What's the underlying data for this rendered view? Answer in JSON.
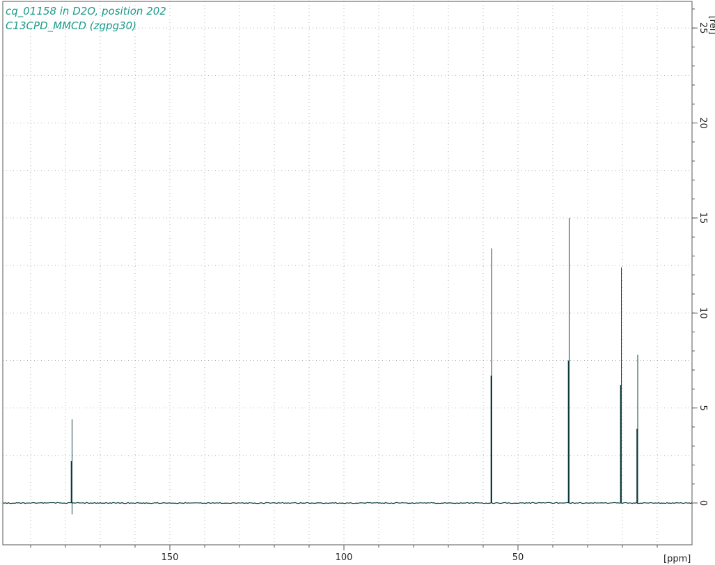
{
  "chart_data": {
    "type": "line",
    "title_lines": [
      "cq_01158 in D2O, position 202",
      "C13CPD_MMCD (zgpg30)"
    ],
    "xlabel": "[ppm]",
    "ylabel": "[rel]",
    "xlim": [
      198,
      0
    ],
    "ylim": [
      -2.2,
      26.4
    ],
    "x_ticks": [
      150,
      100,
      50
    ],
    "x_minor_ticks": [
      190,
      180,
      170,
      160,
      150,
      140,
      130,
      120,
      110,
      100,
      90,
      80,
      70,
      60,
      50,
      40,
      30,
      20,
      10
    ],
    "y_ticks": [
      0,
      5,
      10,
      15,
      20,
      25
    ],
    "grid": true,
    "line_color": "#0b3b3a",
    "title_color": "#1a9a8a",
    "baseline": 0,
    "peaks": [
      {
        "x": 178.1,
        "y": 4.4,
        "inner_y": 2.2,
        "dip": -0.6
      },
      {
        "x": 57.5,
        "y": 13.4,
        "inner_y": 6.7
      },
      {
        "x": 35.3,
        "y": 15.0,
        "inner_y": 7.5
      },
      {
        "x": 20.3,
        "y": 12.4,
        "inner_y": 6.2
      },
      {
        "x": 15.6,
        "y": 7.8,
        "inner_y": 3.9
      }
    ]
  }
}
